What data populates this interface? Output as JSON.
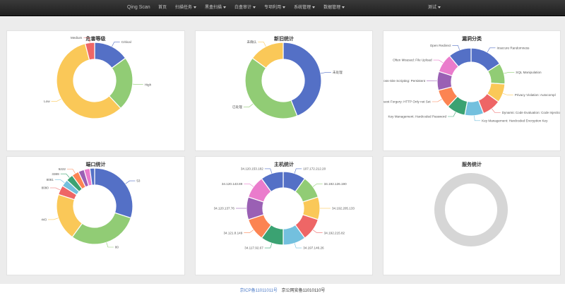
{
  "nav": {
    "brand": "Qing Scan",
    "items": [
      {
        "label": "首页",
        "dropdown": false
      },
      {
        "label": "扫描任务",
        "dropdown": true
      },
      {
        "label": "黑盒扫描",
        "dropdown": true
      },
      {
        "label": "白盒审计",
        "dropdown": true
      },
      {
        "label": "专项利用",
        "dropdown": true
      },
      {
        "label": "系统管理",
        "dropdown": true
      },
      {
        "label": "数据管理",
        "dropdown": true
      }
    ],
    "user": {
      "label": "测试",
      "dropdown": true
    }
  },
  "cards": [
    {
      "title": "危害等级"
    },
    {
      "title": "新旧统计"
    },
    {
      "title": "漏洞分类"
    },
    {
      "title": "端口统计"
    },
    {
      "title": "主机统计"
    },
    {
      "title": "服务统计"
    }
  ],
  "chart_data": [
    {
      "type": "pie",
      "title": "危害等级",
      "labels": [
        "Critical",
        "High",
        "Low",
        "Medium"
      ],
      "values": [
        15,
        23,
        58,
        4
      ],
      "colors": [
        "#5470c6",
        "#91cc75",
        "#fac858",
        "#ee6666"
      ]
    },
    {
      "type": "pie",
      "title": "新旧统计",
      "labels": [
        "未处理",
        "已处理",
        "未确认"
      ],
      "values": [
        44,
        41,
        15
      ],
      "colors": [
        "#5470c6",
        "#91cc75",
        "#fac858"
      ]
    },
    {
      "type": "pie",
      "title": "漏洞分类",
      "labels": [
        "Insecure Randomness",
        "SQL Manipulation",
        "Privacy Violation: Autocompl",
        "Dynamic Code Evaluation: Code Injection",
        "Key Management: Hardcoded Encryption Key",
        "Key Management: Hardcoded Password",
        "Cross-Site Request Forgery: HTTP Only not Set",
        "Cross-Site Scripting: Persistent",
        "Often Misused: File Upload",
        "Open Redirect"
      ],
      "values": [
        16,
        10,
        9,
        9,
        9,
        9,
        9,
        9,
        9,
        11
      ],
      "colors": [
        "#5470c6",
        "#91cc75",
        "#fac858",
        "#ee6666",
        "#73c0de",
        "#3ba272",
        "#fc8452",
        "#9a60b4",
        "#ea7ccc",
        "#5470c6"
      ]
    },
    {
      "type": "pie",
      "title": "端口统计",
      "labels": [
        "53",
        "80",
        "443",
        "8080",
        "8081",
        "3389",
        "5222",
        "",
        "",
        ""
      ],
      "values": [
        30,
        30,
        20,
        4,
        3,
        3,
        3,
        2.5,
        2.5,
        2
      ],
      "colors": [
        "#5470c6",
        "#91cc75",
        "#fac858",
        "#ee6666",
        "#73c0de",
        "#3ba272",
        "#fc8452",
        "#9a60b4",
        "#ea7ccc",
        "#5470c6"
      ]
    },
    {
      "type": "pie",
      "title": "主机统计",
      "labels": [
        "107.172.212.20",
        "34.192.126.190",
        "34.192.205.133",
        "34.192.215.82",
        "34.197.146.26",
        "34.117.92.67",
        "34.121.8.149",
        "34.120.137.76",
        "34.120.143.89",
        "34.120.153.182"
      ],
      "values": [
        10,
        10,
        10,
        10,
        10,
        10,
        10,
        10,
        10,
        10
      ],
      "colors": [
        "#5470c6",
        "#91cc75",
        "#fac858",
        "#ee6666",
        "#73c0de",
        "#3ba272",
        "#fc8452",
        "#9a60b4",
        "#ea7ccc",
        "#5470c6"
      ]
    },
    {
      "type": "pie",
      "title": "服务统计",
      "labels": [],
      "values": [],
      "colors": [
        "#d6d6d6"
      ]
    }
  ],
  "footer": {
    "link_text": "京ICP备11011011号",
    "text": "京公网安备11010110号"
  }
}
